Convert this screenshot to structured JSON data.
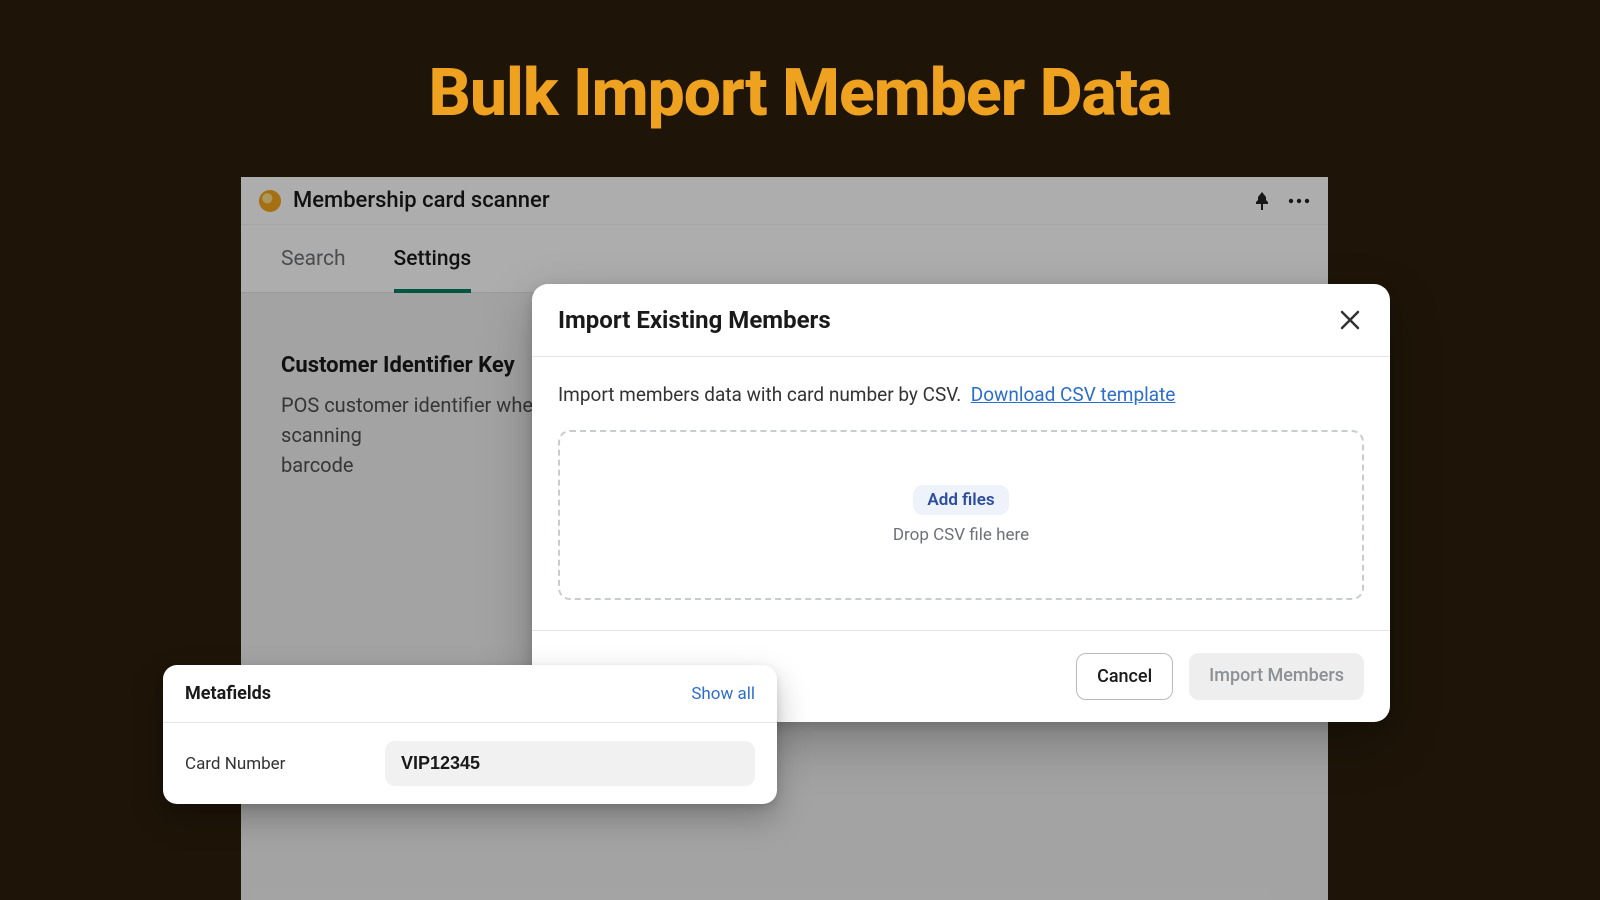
{
  "hero": {
    "title": "Bulk Import Member Data"
  },
  "app": {
    "title": "Membership card scanner",
    "tabs": {
      "search": "Search",
      "settings": "Settings"
    },
    "section": {
      "heading": "Customer Identifier Key",
      "desc_line1": "POS customer identifier when scanning",
      "desc_line2": "barcode"
    }
  },
  "modal": {
    "title": "Import Existing Members",
    "subtext": "Import members data with card number by CSV.",
    "link_text": "Download CSV template",
    "add_files": "Add files",
    "drop_hint": "Drop CSV file here",
    "cancel": "Cancel",
    "import": "Import Members"
  },
  "metafields": {
    "title": "Metafields",
    "show_all": "Show all",
    "field_label": "Card Number",
    "field_value": "VIP12345"
  }
}
